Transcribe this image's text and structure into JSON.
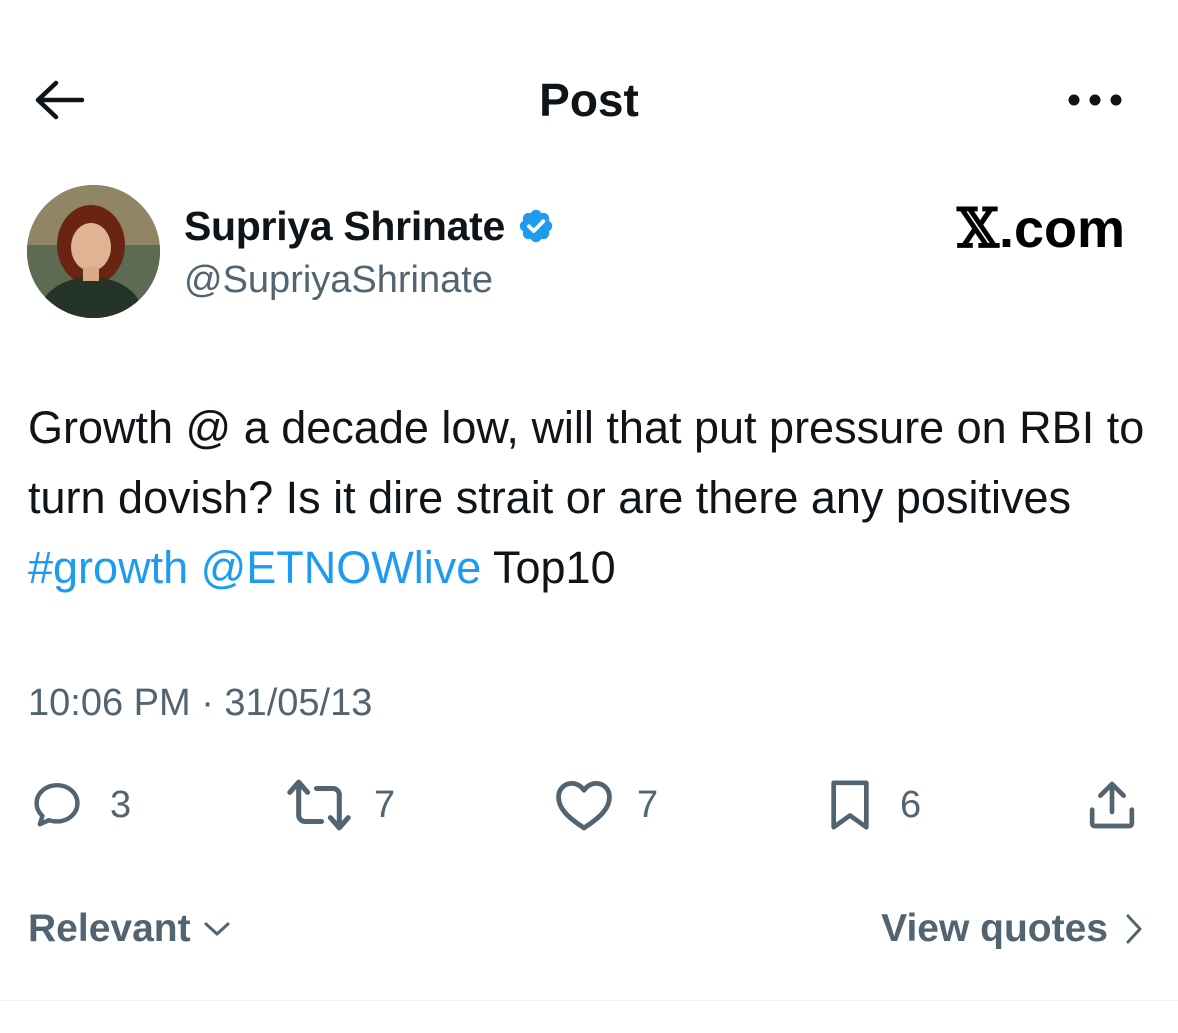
{
  "header": {
    "title": "Post",
    "back_icon": "arrow-left-icon",
    "more_icon": "more-horizontal-icon"
  },
  "author": {
    "name": "Supriya Shrinate",
    "handle": "@SupriyaShrinate",
    "verified": true,
    "verified_color": "#1d9bf0"
  },
  "watermark": {
    "x_glyph": "𝕏",
    "domain": ".com"
  },
  "post": {
    "text_line1": "Growth @ a decade low, will that put pressure on RBI to turn dovish? Is it dire strait or are there any positives ",
    "hashtag": "#growth",
    "space": " ",
    "mention": "@ETNOWlive",
    "text_tail": " Top10",
    "link_color": "#1d9bf0"
  },
  "timestamp": "10:06 PM · 31/05/13",
  "actions": {
    "replies": "3",
    "reposts": "7",
    "likes": "7",
    "bookmarks": "6"
  },
  "footer": {
    "sort_label": "Relevant",
    "view_quotes_label": "View quotes"
  }
}
